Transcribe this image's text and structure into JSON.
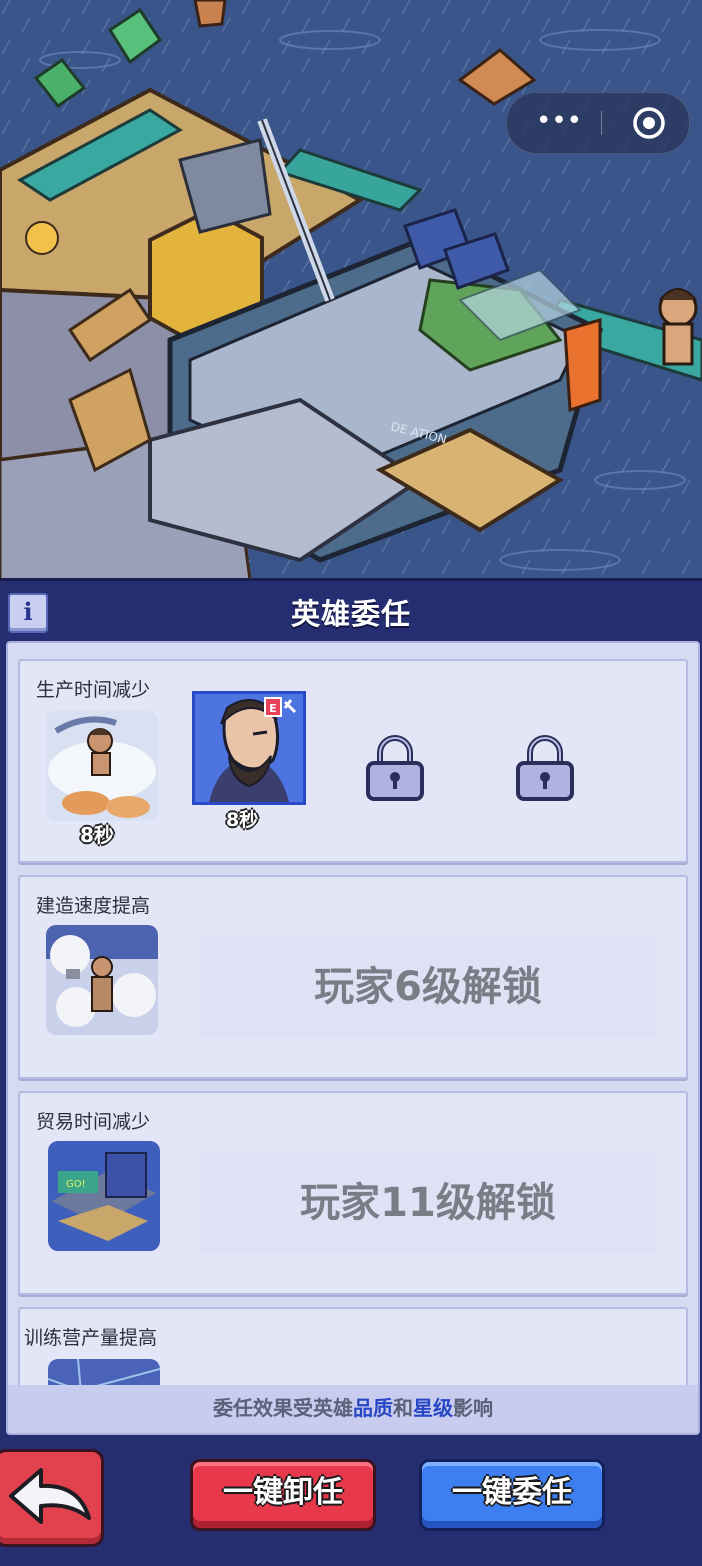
{
  "header": {
    "title": "英雄委任",
    "info_icon_label": "i"
  },
  "capsule": {
    "menu_icon": "more-dots-icon",
    "close_icon": "target-icon",
    "menu_label": "•••"
  },
  "cards": [
    {
      "title": "生产时间减少",
      "thumb_time": "8秒",
      "hero_time": "8秒",
      "slots": [
        "hero",
        "locked",
        "locked"
      ]
    },
    {
      "title": "建造速度提高",
      "lock_text": "玩家6级解锁"
    },
    {
      "title": "贸易时间减少",
      "lock_text": "玩家11级解锁"
    },
    {
      "title": "训练营产量提高"
    }
  ],
  "footer": {
    "pre": "委任效果受英雄",
    "hl1": "品质",
    "mid": "和",
    "hl2": "星级",
    "post": "影响"
  },
  "buttons": {
    "back_icon": "back-arrow-icon",
    "dismiss_all": "一键卸任",
    "assign_all": "一键委任"
  },
  "colors": {
    "panel_bg": "#262e72",
    "card_bg": "#e3e6f6",
    "red_button": "#e8384c",
    "blue_button": "#3d7ef0",
    "highlight": "#2746c4"
  }
}
